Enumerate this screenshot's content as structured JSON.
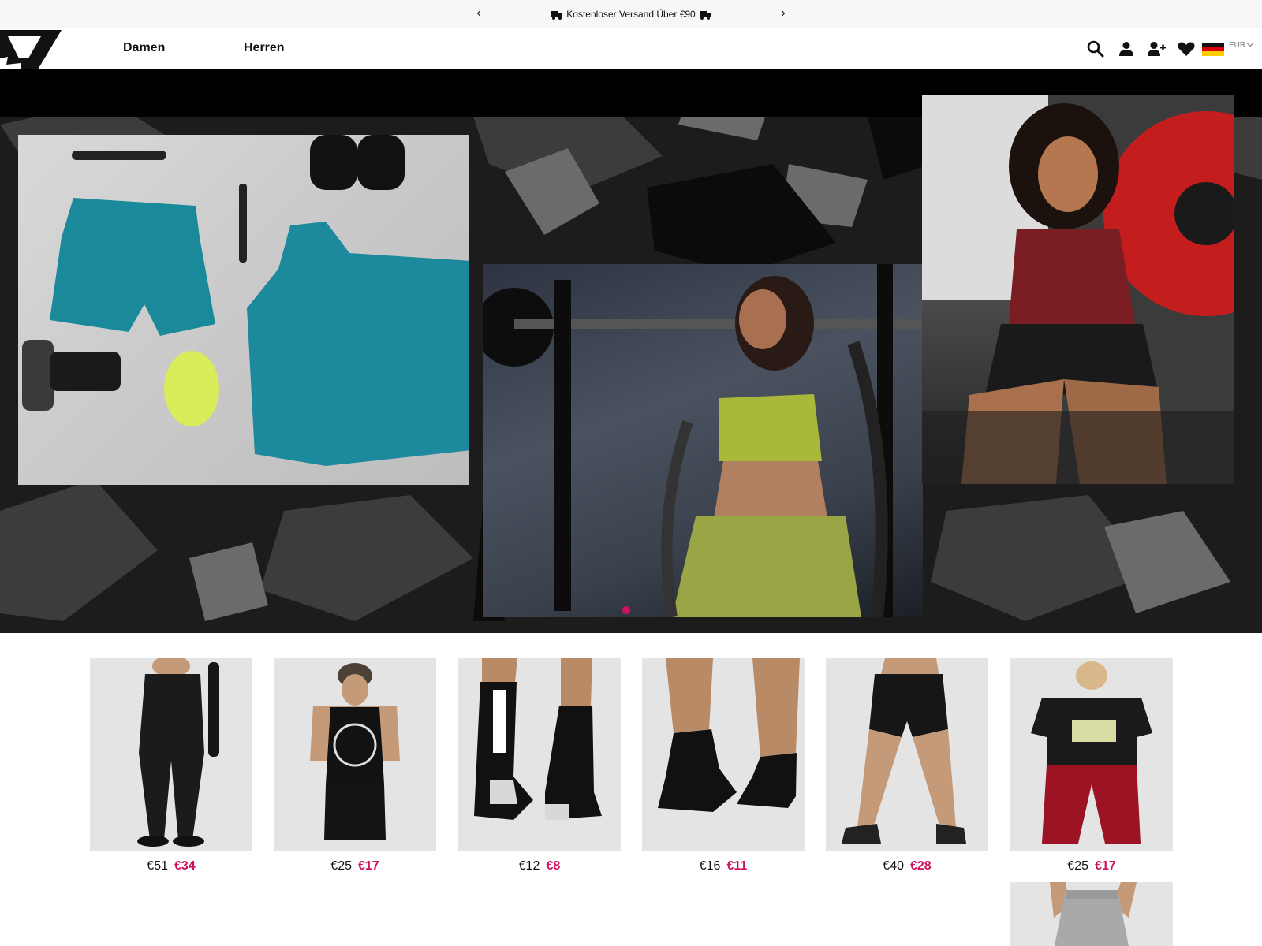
{
  "announcement": {
    "prev": "‹",
    "next": "›",
    "message": "Kostenloser Versand Über €90"
  },
  "header": {
    "logo": "gymshark-logo",
    "nav": [
      {
        "label": "Damen"
      },
      {
        "label": "Herren"
      }
    ],
    "icons": [
      "search-icon",
      "account-icon",
      "add-user-icon",
      "wishlist-heart-icon"
    ],
    "country_flag": "germany-flag",
    "currency": "EUR"
  },
  "hero": {
    "active_slide": 1,
    "slide_count": 1,
    "accent_color": "#d1105f"
  },
  "products": [
    {
      "name_icon": "leggings-product-image",
      "old_price": "€51",
      "new_price": "€34"
    },
    {
      "name_icon": "tank-top-product-image",
      "old_price": "€25",
      "new_price": "€17"
    },
    {
      "name_icon": "crew-socks-product-image",
      "old_price": "€12",
      "new_price": "€8"
    },
    {
      "name_icon": "ankle-socks-product-image",
      "old_price": "€16",
      "new_price": "€11"
    },
    {
      "name_icon": "shorts-product-image",
      "old_price": "€40",
      "new_price": "€28"
    },
    {
      "name_icon": "crop-tee-product-image",
      "old_price": "€25",
      "new_price": "€17"
    }
  ],
  "colors": {
    "sale": "#d1105f",
    "announcement_bg": "#f7f7f7"
  }
}
